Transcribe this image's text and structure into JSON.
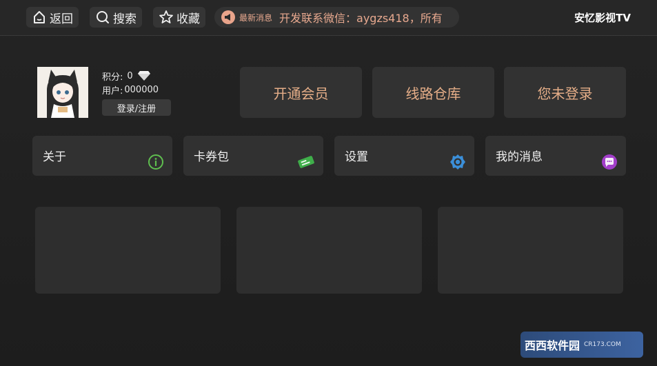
{
  "topbar": {
    "back_label": "返回",
    "search_label": "搜索",
    "favorites_label": "收藏",
    "notice_tag": "最新消息",
    "notice_text": "开发联系微信：aygzs418，所有",
    "app_title": "安忆影视TV"
  },
  "user": {
    "points_label": "积分:",
    "points_value": "0",
    "user_label": "用户:",
    "user_value": "000000",
    "login_label": "登录/注册"
  },
  "actions": [
    {
      "label": "开通会员"
    },
    {
      "label": "线路仓库"
    },
    {
      "label": "您未登录"
    }
  ],
  "menu": [
    {
      "label": "关于",
      "icon": "info-icon",
      "color": "#5fbf4f"
    },
    {
      "label": "卡券包",
      "icon": "ticket-icon",
      "color": "#3fae4a"
    },
    {
      "label": "设置",
      "icon": "gear-icon",
      "color": "#3b8fd9"
    },
    {
      "label": "我的消息",
      "icon": "chat-icon",
      "color": "#a23ec9"
    }
  ],
  "watermark": {
    "main": "西西软件园",
    "sub": "CR173.COM"
  },
  "colors": {
    "accent": "#e6ae88",
    "background": "#1f1f1f"
  }
}
